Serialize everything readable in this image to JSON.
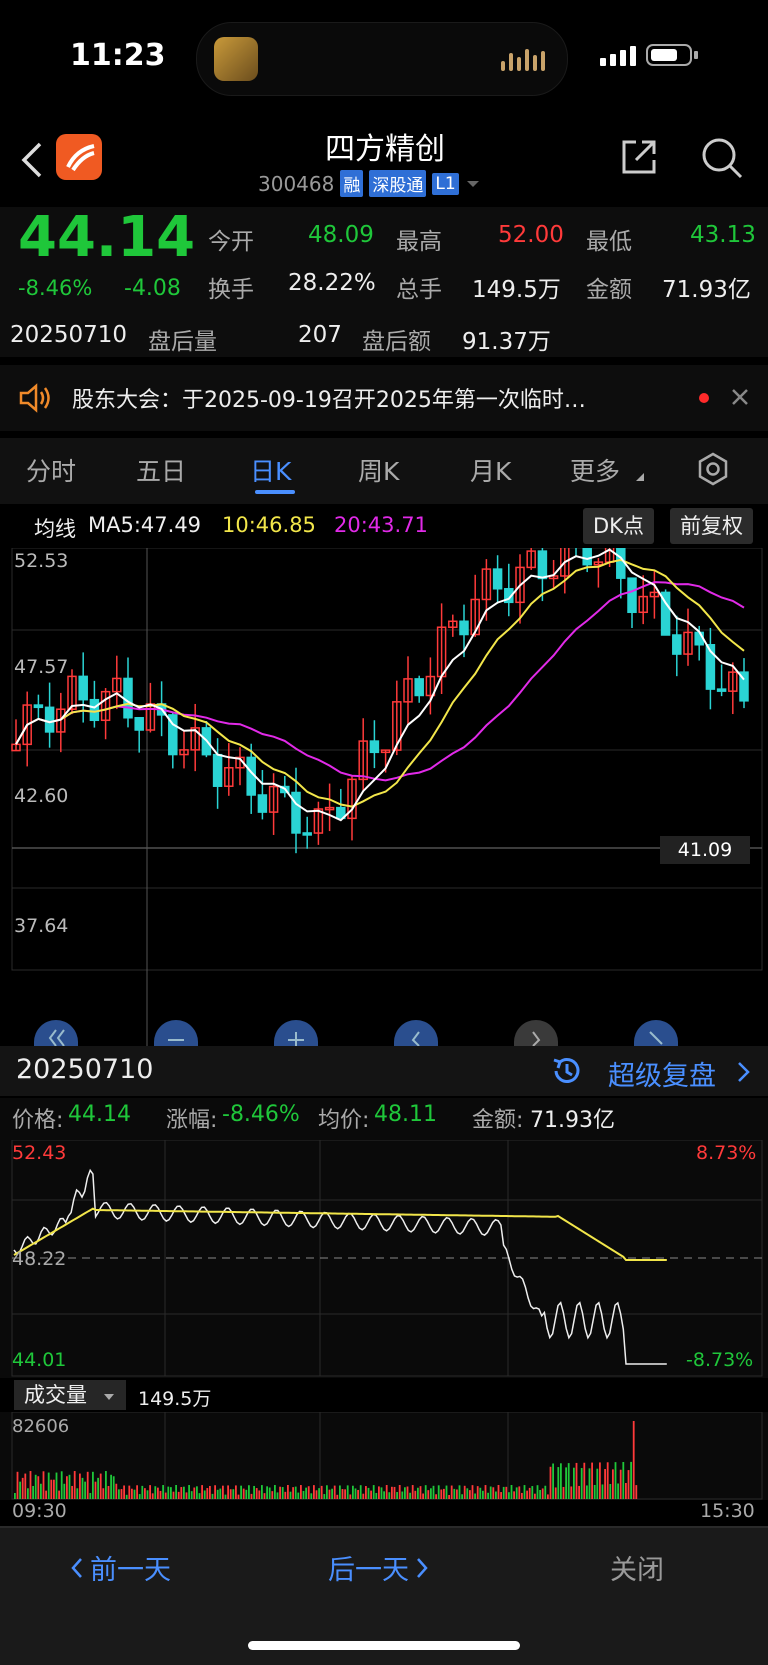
{
  "status": {
    "time": "11:23"
  },
  "header": {
    "name": "四方精创",
    "code": "300468",
    "tags": [
      "融",
      "深股通",
      "L1"
    ]
  },
  "quote": {
    "price": "44.14",
    "change_pct": "-8.46%",
    "change": "-4.08",
    "open_label": "今开",
    "open": "48.09",
    "high_label": "最高",
    "high": "52.00",
    "low_label": "最低",
    "low": "43.13",
    "turnover_label": "换手",
    "turnover": "28.22%",
    "volume_label": "总手",
    "volume": "149.5万",
    "amount_label": "金额",
    "amount": "71.93亿",
    "date": "20250710",
    "after_vol_label": "盘后量",
    "after_vol": "207",
    "after_amt_label": "盘后额",
    "after_amt": "91.37万"
  },
  "notice": {
    "text": "股东大会：于2025-09-19召开2025年第一次临时…"
  },
  "tabs": [
    "分时",
    "五日",
    "日K",
    "周K",
    "月K",
    "更多"
  ],
  "ma": {
    "label": "均线",
    "ma5": "MA5:47.49",
    "ma10": "10:46.85",
    "ma20": "20:43.71"
  },
  "buttons": {
    "dk": "DK点",
    "fq": "前复权"
  },
  "kline_labels": {
    "y1": "52.53",
    "y2": "47.57",
    "y3": "42.60",
    "y4": "37.64",
    "cursor": "41.09"
  },
  "detail": {
    "date": "20250710",
    "replay": "超级复盘",
    "price_label": "价格:",
    "price": "44.14",
    "pct_label": "涨幅:",
    "pct": "-8.46%",
    "avg_label": "均价:",
    "avg": "48.11",
    "amt_label": "金额:",
    "amt": "71.93亿"
  },
  "intraday": {
    "top": "52.43",
    "mid": "48.22",
    "bottom": "44.01",
    "top_pct": "8.73%",
    "bottom_pct": "-8.73%"
  },
  "volume": {
    "label": "成交量",
    "total": "149.5万",
    "max": "82606",
    "start": "09:30",
    "end": "15:30"
  },
  "bottom": {
    "prev": "前一天",
    "next": "后一天",
    "close": "关闭"
  },
  "colors": {
    "up": "#ff3a3a",
    "down": "#2ad4d4",
    "ma5": "#ffffff",
    "ma10": "#f2e64a",
    "ma20": "#e12ae8",
    "accent": "#4a8fff"
  }
}
